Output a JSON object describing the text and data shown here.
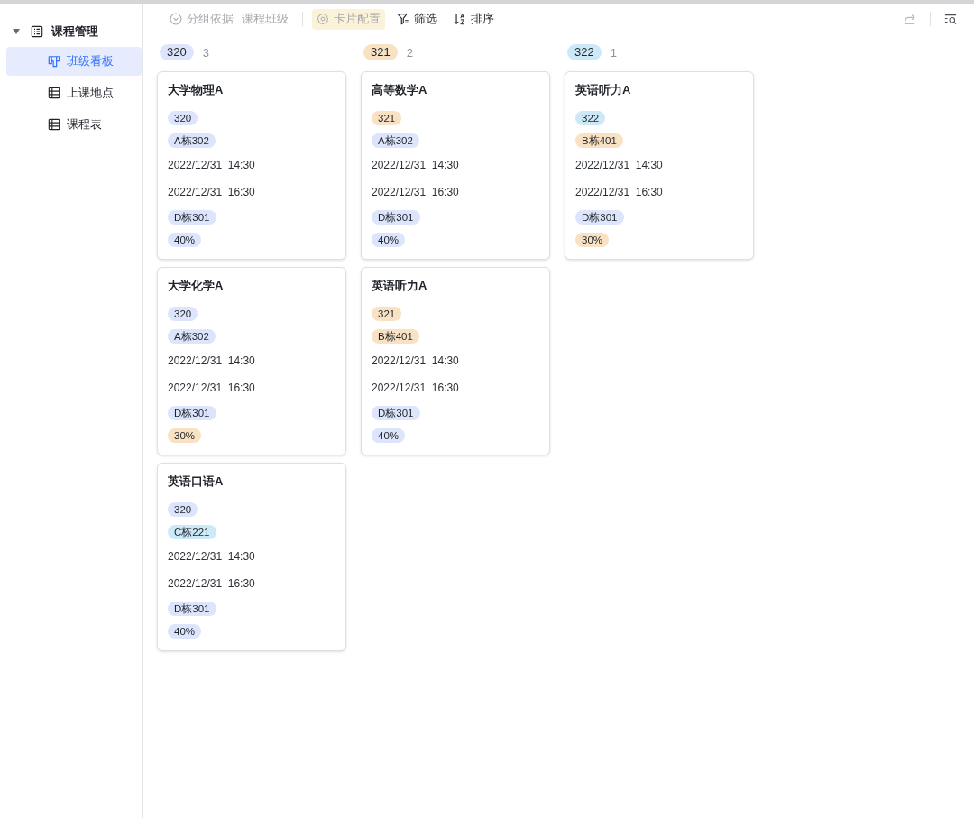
{
  "sidebar": {
    "items": [
      {
        "label": "课程管理",
        "kind": "base",
        "expanded": true,
        "children": [
          {
            "label": "班级看板",
            "kind": "board",
            "selected": true
          },
          {
            "label": "上课地点",
            "kind": "table",
            "selected": false
          },
          {
            "label": "课程表",
            "kind": "table",
            "selected": false
          }
        ]
      }
    ]
  },
  "toolbar": {
    "items": [
      {
        "kind": "group",
        "label": "分组依据",
        "value": "课程班级",
        "disabled": true,
        "highlighted": false
      },
      {
        "kind": "config",
        "label": "卡片配置",
        "disabled": true,
        "highlighted": true
      },
      {
        "kind": "filter",
        "label": "筛选",
        "disabled": false,
        "highlighted": false
      },
      {
        "kind": "sort",
        "label": "排序",
        "disabled": false,
        "highlighted": false
      }
    ],
    "right_tools": [
      {
        "kind": "share",
        "disabled": true
      },
      {
        "kind": "search",
        "disabled": false
      }
    ]
  },
  "columns": [
    {
      "group": "320",
      "color": "#dde5fc",
      "count": "3",
      "cards": [
        {
          "title": "大学物理A",
          "fields": [
            {
              "kind": "tag",
              "text": "320",
              "color": "#dde5fc"
            },
            {
              "kind": "tag",
              "text": "A栋302",
              "color": "#dde5fc"
            },
            {
              "kind": "text",
              "text": "2022/12/31  14:30"
            },
            {
              "kind": "text",
              "text": "2022/12/31  16:30"
            },
            {
              "kind": "tag",
              "text": "D栋301",
              "color": "#dde5fc"
            },
            {
              "kind": "tag",
              "text": "40%",
              "color": "#dde5fc"
            }
          ]
        },
        {
          "title": "大学化学A",
          "fields": [
            {
              "kind": "tag",
              "text": "320",
              "color": "#dde5fc"
            },
            {
              "kind": "tag",
              "text": "A栋302",
              "color": "#dde5fc"
            },
            {
              "kind": "text",
              "text": "2022/12/31  14:30"
            },
            {
              "kind": "text",
              "text": "2022/12/31  16:30"
            },
            {
              "kind": "tag",
              "text": "D栋301",
              "color": "#dde5fc"
            },
            {
              "kind": "tag",
              "text": "30%",
              "color": "#f9e2c4"
            }
          ]
        },
        {
          "title": "英语口语A",
          "fields": [
            {
              "kind": "tag",
              "text": "320",
              "color": "#dde5fc"
            },
            {
              "kind": "tag",
              "text": "C栋221",
              "color": "#cde9f8"
            },
            {
              "kind": "text",
              "text": "2022/12/31  14:30"
            },
            {
              "kind": "text",
              "text": "2022/12/31  16:30"
            },
            {
              "kind": "tag",
              "text": "D栋301",
              "color": "#dde5fc"
            },
            {
              "kind": "tag",
              "text": "40%",
              "color": "#dde5fc"
            }
          ]
        }
      ]
    },
    {
      "group": "321",
      "color": "#f9e2c4",
      "count": "2",
      "cards": [
        {
          "title": "高等数学A",
          "fields": [
            {
              "kind": "tag",
              "text": "321",
              "color": "#f9e2c4"
            },
            {
              "kind": "tag",
              "text": "A栋302",
              "color": "#dde5fc"
            },
            {
              "kind": "text",
              "text": "2022/12/31  14:30"
            },
            {
              "kind": "text",
              "text": "2022/12/31  16:30"
            },
            {
              "kind": "tag",
              "text": "D栋301",
              "color": "#dde5fc"
            },
            {
              "kind": "tag",
              "text": "40%",
              "color": "#dde5fc"
            }
          ]
        },
        {
          "title": "英语听力A",
          "fields": [
            {
              "kind": "tag",
              "text": "321",
              "color": "#f9e2c4"
            },
            {
              "kind": "tag",
              "text": "B栋401",
              "color": "#f9e2c4"
            },
            {
              "kind": "text",
              "text": "2022/12/31  14:30"
            },
            {
              "kind": "text",
              "text": "2022/12/31  16:30"
            },
            {
              "kind": "tag",
              "text": "D栋301",
              "color": "#dde5fc"
            },
            {
              "kind": "tag",
              "text": "40%",
              "color": "#dde5fc"
            }
          ]
        }
      ]
    },
    {
      "group": "322",
      "color": "#cde9f8",
      "count": "1",
      "cards": [
        {
          "title": "英语听力A",
          "fields": [
            {
              "kind": "tag",
              "text": "322",
              "color": "#cde9f8"
            },
            {
              "kind": "tag",
              "text": "B栋401",
              "color": "#f9e2c4"
            },
            {
              "kind": "text",
              "text": "2022/12/31  14:30"
            },
            {
              "kind": "text",
              "text": "2022/12/31  16:30"
            },
            {
              "kind": "tag",
              "text": "D栋301",
              "color": "#dde5fc"
            },
            {
              "kind": "tag",
              "text": "30%",
              "color": "#f9e2c4"
            }
          ]
        }
      ]
    }
  ]
}
